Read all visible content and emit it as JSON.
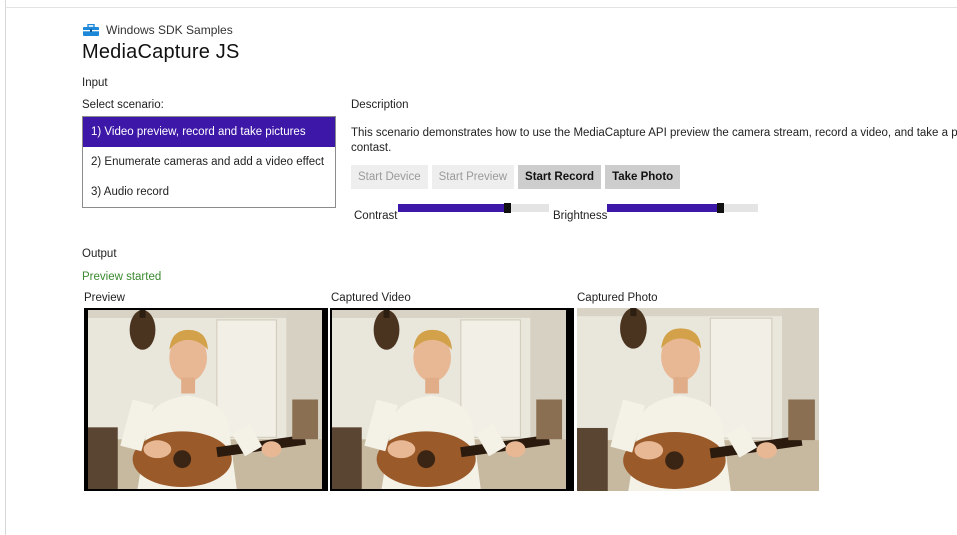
{
  "header": {
    "brand": "Windows SDK Samples",
    "title": "MediaCapture JS"
  },
  "input": {
    "heading": "Input",
    "scenario_label": "Select scenario:",
    "scenarios": [
      {
        "label": "1) Video preview, record and take pictures",
        "selected": true
      },
      {
        "label": "2) Enumerate cameras and add a video effect",
        "selected": false
      },
      {
        "label": "3) Audio record",
        "selected": false
      }
    ],
    "description_label": "Description",
    "description_line1": "This scenario demonstrates how to use the MediaCapture API preview the camera stream, record a video, and take a pictu",
    "description_line2": "contast."
  },
  "controls": {
    "buttons": [
      {
        "label": "Start Device",
        "enabled": false
      },
      {
        "label": "Start Preview",
        "enabled": false
      },
      {
        "label": "Start Record",
        "enabled": true
      },
      {
        "label": "Take Photo",
        "enabled": true
      }
    ],
    "contrast_label": "Contrast",
    "contrast_value": 0.7,
    "brightness_label": "Brightness",
    "brightness_value": 0.73
  },
  "output": {
    "heading": "Output",
    "status": "Preview started",
    "status_color": "#3a8a2f",
    "preview_label": "Preview",
    "video_label": "Captured Video",
    "photo_label": "Captured Photo"
  },
  "accent_color": "#3d17a7"
}
